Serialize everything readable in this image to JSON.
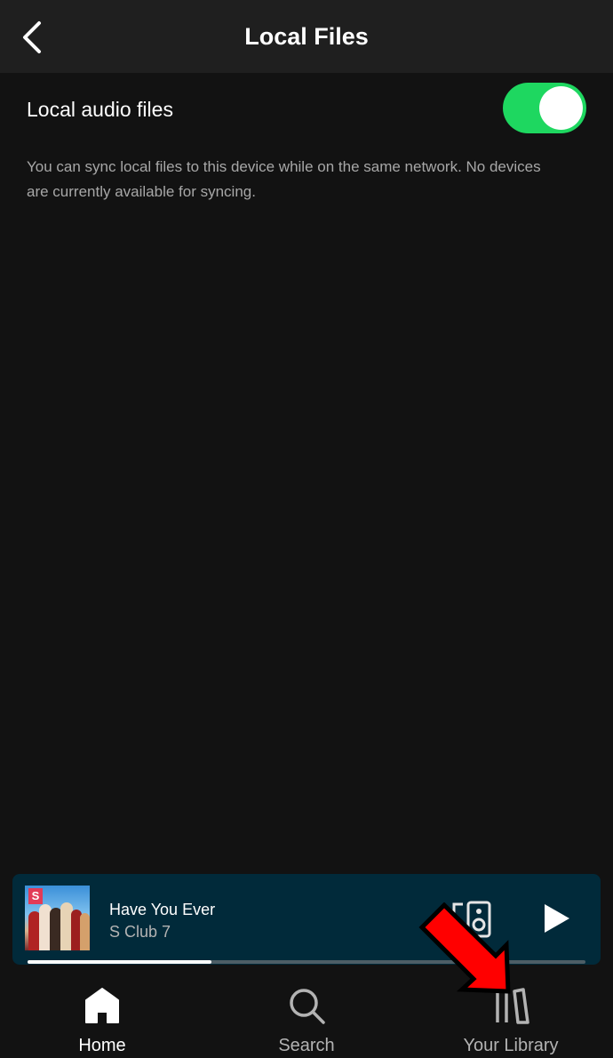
{
  "header": {
    "title": "Local Files"
  },
  "setting": {
    "label": "Local audio files",
    "enabled": true,
    "help_text": "You can sync local files to this device while on the same network. No devices are currently available for syncing."
  },
  "player": {
    "track_title": "Have You Ever",
    "artist": "S Club 7",
    "progress": 0.33,
    "album_logo": "S"
  },
  "nav": [
    {
      "label": "Home",
      "icon": "home-icon",
      "active": true
    },
    {
      "label": "Search",
      "icon": "search-icon",
      "active": false
    },
    {
      "label": "Your Library",
      "icon": "library-icon",
      "active": false
    }
  ],
  "colors": {
    "accent": "#1ed760",
    "background": "#121212",
    "player_bg": "#012a3a",
    "annotation": "#ff0000"
  }
}
